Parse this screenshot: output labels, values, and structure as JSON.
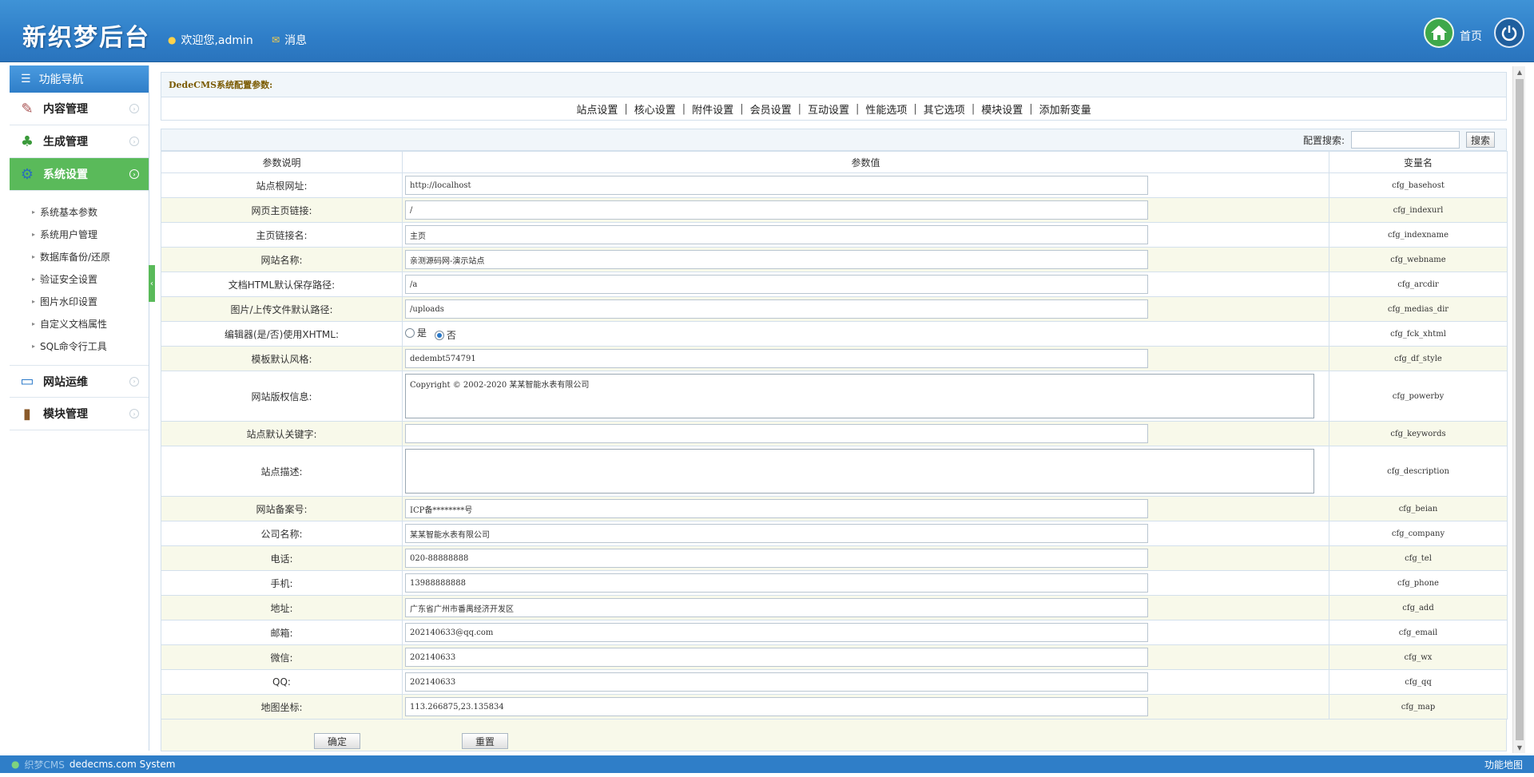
{
  "header": {
    "logo": "新织梦后台",
    "welcome": "欢迎您,admin",
    "messages": "消息",
    "home": "首页"
  },
  "sidebar": {
    "title": "功能导航",
    "groups": [
      {
        "label": "内容管理",
        "icon": "edit-icon"
      },
      {
        "label": "生成管理",
        "icon": "tree-icon"
      },
      {
        "label": "系统设置",
        "icon": "gears-icon"
      },
      {
        "label": "网站运维",
        "icon": "monitor-icon"
      },
      {
        "label": "模块管理",
        "icon": "book-icon"
      }
    ],
    "system_items": [
      "系统基本参数",
      "系统用户管理",
      "数据库备份/还原",
      "验证安全设置",
      "图片水印设置",
      "自定义文档属性",
      "SQL命令行工具"
    ]
  },
  "main": {
    "panel_title": "DedeCMS系统配置参数:",
    "tabs": [
      "站点设置",
      "核心设置",
      "附件设置",
      "会员设置",
      "互动设置",
      "性能选项",
      "其它选项",
      "模块设置",
      "添加新变量"
    ],
    "search_label": "配置搜索:",
    "search_value": "",
    "search_button": "搜索",
    "columns": [
      "参数说明",
      "参数值",
      "变量名"
    ],
    "rows": [
      {
        "label": "站点根网址:",
        "value": "http://localhost",
        "var": "cfg_basehost"
      },
      {
        "label": "网页主页链接:",
        "value": "/",
        "var": "cfg_indexurl"
      },
      {
        "label": "主页链接名:",
        "value": "主页",
        "var": "cfg_indexname"
      },
      {
        "label": "网站名称:",
        "value": "亲测源码网-演示站点",
        "var": "cfg_webname"
      },
      {
        "label": "文档HTML默认保存路径:",
        "value": "/a",
        "var": "cfg_arcdir"
      },
      {
        "label": "图片/上传文件默认路径:",
        "value": "/uploads",
        "var": "cfg_medias_dir"
      },
      {
        "label": "编辑器(是/否)使用XHTML:",
        "radio_yes": "是",
        "radio_no": "否",
        "selected": "否",
        "var": "cfg_fck_xhtml"
      },
      {
        "label": "模板默认风格:",
        "value": "dedembt574791",
        "var": "cfg_df_style"
      },
      {
        "label": "网站版权信息:",
        "value": "Copyright © 2002-2020 某某智能水表有限公司",
        "var": "cfg_powerby"
      },
      {
        "label": "站点默认关键字:",
        "value": "",
        "var": "cfg_keywords"
      },
      {
        "label": "站点描述:",
        "value": "",
        "var": "cfg_description"
      },
      {
        "label": "网站备案号:",
        "value": "ICP备********号",
        "var": "cfg_beian"
      },
      {
        "label": "公司名称:",
        "value": "某某智能水表有限公司",
        "var": "cfg_company"
      },
      {
        "label": "电话:",
        "value": "020-88888888",
        "var": "cfg_tel"
      },
      {
        "label": "手机:",
        "value": "13988888888",
        "var": "cfg_phone"
      },
      {
        "label": "地址:",
        "value": "广东省广州市番禺经济开发区",
        "var": "cfg_add"
      },
      {
        "label": "邮箱:",
        "value": "202140633@qq.com",
        "var": "cfg_email"
      },
      {
        "label": "微信:",
        "value": "202140633",
        "var": "cfg_wx"
      },
      {
        "label": "QQ:",
        "value": "202140633",
        "var": "cfg_qq"
      },
      {
        "label": "地图坐标:",
        "value": "113.266875,23.135834",
        "var": "cfg_map"
      }
    ],
    "submit": "确定",
    "reset": "重置"
  },
  "footer": {
    "brand": "织梦CMS",
    "system": "dedecms.com System",
    "sitemap": "功能地图"
  }
}
